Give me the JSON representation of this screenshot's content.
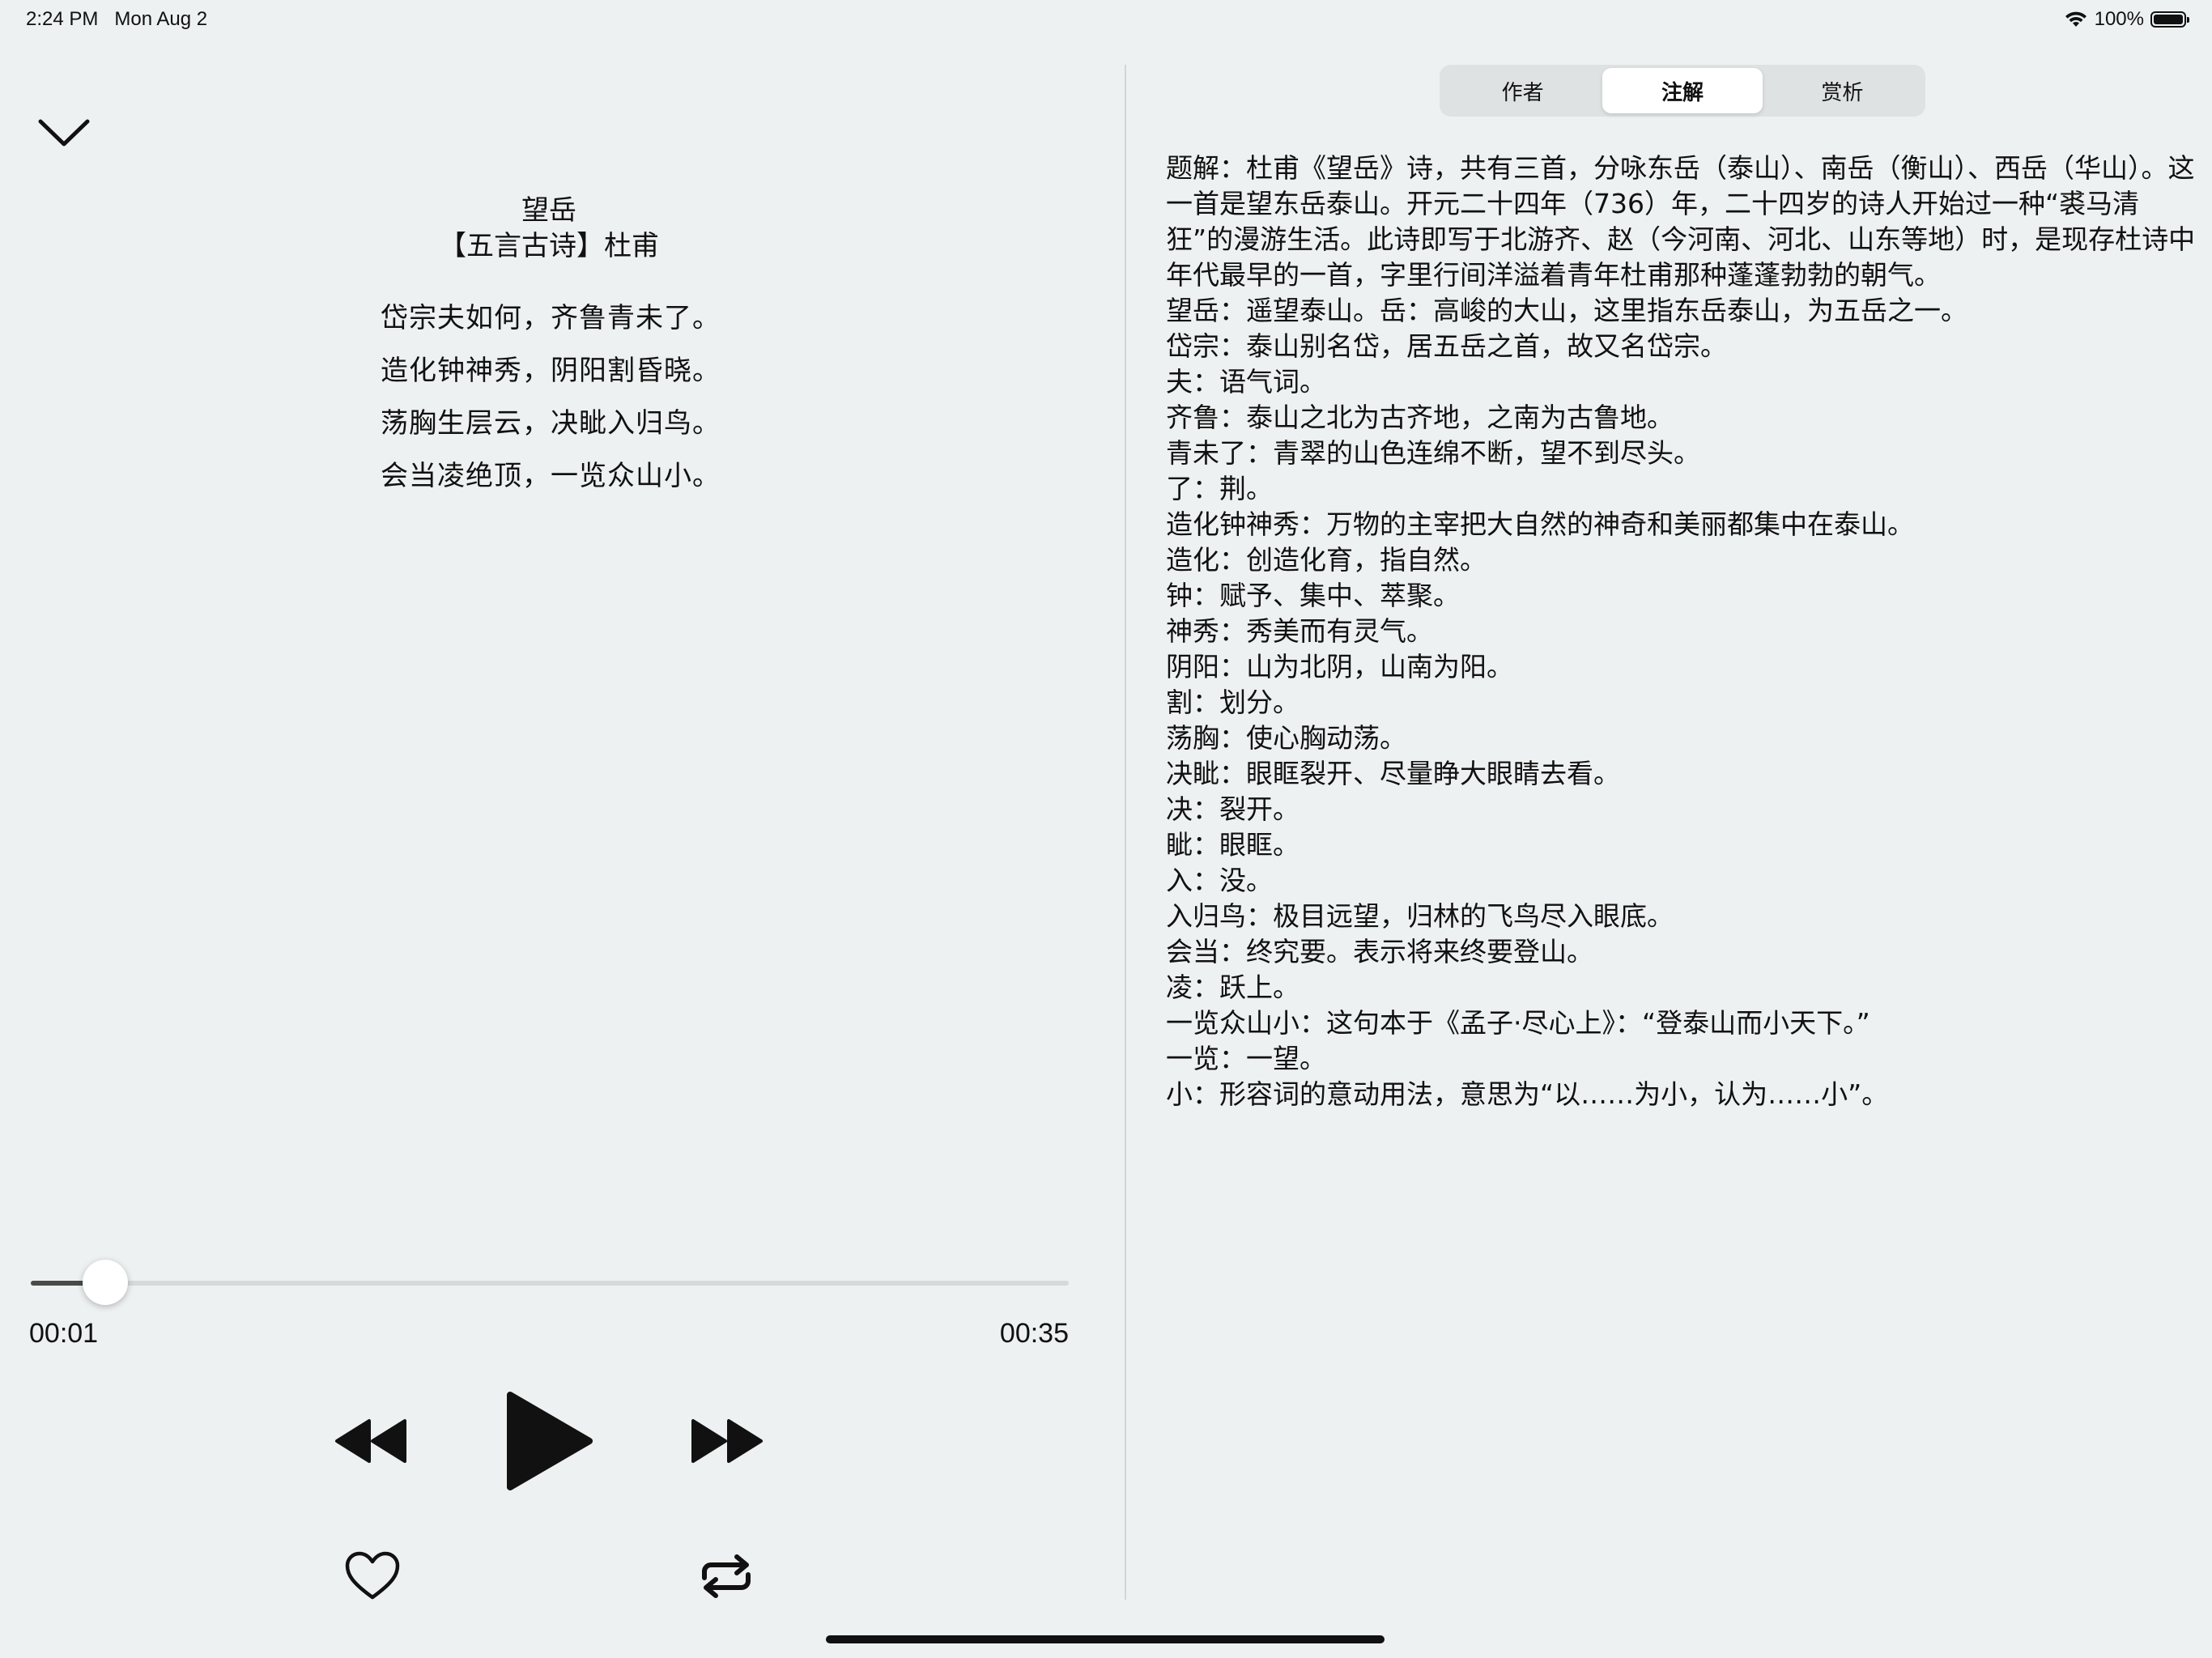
{
  "status_bar": {
    "time": "2:24 PM",
    "date": "Mon Aug 2",
    "battery_text": "100%",
    "icons": [
      "wifi-icon",
      "battery-icon"
    ]
  },
  "player": {
    "collapse_icon": "chevron-down-icon",
    "title": "望岳",
    "meta": "【五言古诗】杜甫",
    "lines": [
      "岱宗夫如何，齐鲁青未了。",
      "造化钟神秀，阴阳割昏晓。",
      "荡胸生层云，决眦入归鸟。",
      "会当凌绝顶，一览众山小。"
    ],
    "progress_fraction": 0.072,
    "elapsed": "00:01",
    "total": "00:35",
    "controls": [
      "rewind-icon",
      "play-icon",
      "fast-forward-icon"
    ],
    "actions": [
      "heart-icon",
      "repeat-icon"
    ]
  },
  "tabs": {
    "items": [
      {
        "label": "作者"
      },
      {
        "label": "注解"
      },
      {
        "label": "赏析"
      }
    ],
    "selected_index": 1
  },
  "notes": [
    "题解：杜甫《望岳》诗，共有三首，分咏东岳（泰山）、南岳（衡山）、西岳（华山）。这一首是望东岳泰山。开元二十四年（736）年，二十四岁的诗人开始过一种“裘马清狂”的漫游生活。此诗即写于北游齐、赵（今河南、河北、山东等地）时，是现存杜诗中年代最早的一首，字里行间洋溢着青年杜甫那种蓬蓬勃勃的朝气。",
    "望岳：遥望泰山。岳：高峻的大山，这里指东岳泰山，为五岳之一。",
    "岱宗：泰山别名岱，居五岳之首，故又名岱宗。",
    "夫：语气词。",
    "齐鲁：泰山之北为古齐地，之南为古鲁地。",
    "青未了：青翠的山色连绵不断，望不到尽头。",
    "了：荆。",
    "造化钟神秀：万物的主宰把大自然的神奇和美丽都集中在泰山。",
    "造化：创造化育，指自然。",
    "钟：赋予、集中、萃聚。",
    "神秀：秀美而有灵气。",
    "阴阳：山为北阴，山南为阳。",
    "割：划分。",
    "荡胸：使心胸动荡。",
    "决眦：眼眶裂开、尽量睁大眼睛去看。",
    "决：裂开。",
    "眦：眼眶。",
    "入：没。",
    "入归鸟：极目远望，归林的飞鸟尽入眼底。",
    "会当：终究要。表示将来终要登山。",
    "凌：跃上。",
    "一览众山小：这句本于《孟子·尽心上》：“登泰山而小天下。”",
    "一览：一望。",
    "小：形容词的意动用法，意思为“以……为小，认为……小”。"
  ]
}
